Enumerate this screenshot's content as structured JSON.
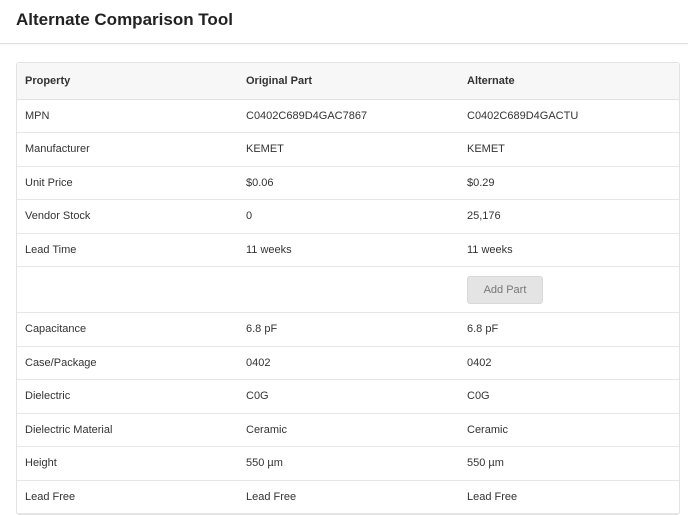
{
  "header": {
    "title": "Alternate Comparison Tool"
  },
  "table": {
    "columns": [
      "Property",
      "Original Part",
      "Alternate"
    ],
    "rows_top": [
      {
        "property": "MPN",
        "original": "C0402C689D4GAC7867",
        "alternate": "C0402C689D4GACTU"
      },
      {
        "property": "Manufacturer",
        "original": "KEMET",
        "alternate": "KEMET"
      },
      {
        "property": "Unit Price",
        "original": "$0.06",
        "alternate": "$0.29"
      },
      {
        "property": "Vendor Stock",
        "original": "0",
        "alternate": "25,176"
      },
      {
        "property": "Lead Time",
        "original": "11 weeks",
        "alternate": "11 weeks"
      }
    ],
    "add_button_label": "Add Part",
    "rows_bottom": [
      {
        "property": "Capacitance",
        "original": "6.8 pF",
        "alternate": "6.8 pF"
      },
      {
        "property": "Case/Package",
        "original": "0402",
        "alternate": "0402"
      },
      {
        "property": "Dielectric",
        "original": "C0G",
        "alternate": "C0G"
      },
      {
        "property": "Dielectric Material",
        "original": "Ceramic",
        "alternate": "Ceramic"
      },
      {
        "property": "Height",
        "original": "550 µm",
        "alternate": "550 µm"
      },
      {
        "property": "Lead Free",
        "original": "Lead Free",
        "alternate": "Lead Free"
      }
    ]
  }
}
